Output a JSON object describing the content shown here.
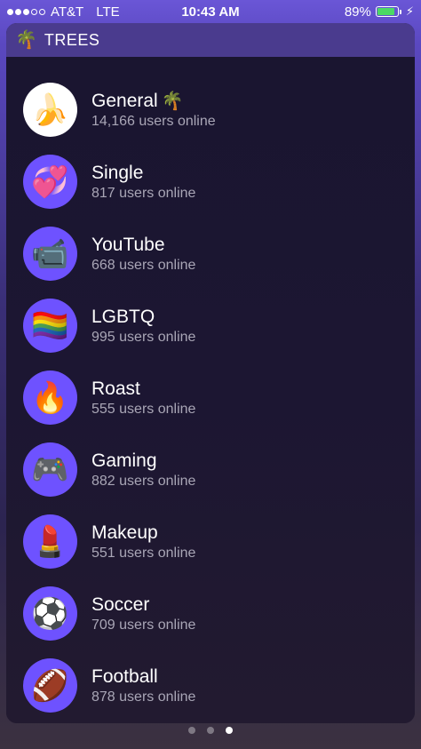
{
  "status_bar": {
    "carrier": "AT&T",
    "network": "LTE",
    "time": "10:43 AM",
    "battery_percent": "89%",
    "battery_level": 0.89,
    "signal_bars": 3,
    "signal_total": 5
  },
  "widget": {
    "title": "TREES",
    "icon": "palm-tree-icon",
    "icon_glyph": "🌴"
  },
  "rooms": [
    {
      "name": "General",
      "name_emoji": "🌴",
      "count": "14,166 users online",
      "icon": "banana-icon",
      "glyph": "🍌",
      "bg": "#ffffff"
    },
    {
      "name": "Single",
      "count": "817 users online",
      "icon": "two-hearts-icon",
      "glyph": "💞",
      "bg": "#6e52ff"
    },
    {
      "name": "YouTube",
      "count": "668 users online",
      "icon": "video-camera-icon",
      "glyph": "📹",
      "bg": "#6e52ff"
    },
    {
      "name": "LGBTQ",
      "count": "995 users online",
      "icon": "rainbow-flag-icon",
      "glyph": "🏳️‍🌈",
      "bg": "#6e52ff"
    },
    {
      "name": "Roast",
      "count": "555 users online",
      "icon": "fire-icon",
      "glyph": "🔥",
      "bg": "#6e52ff"
    },
    {
      "name": "Gaming",
      "count": "882 users online",
      "icon": "game-controller-icon",
      "glyph": "🎮",
      "bg": "#6e52ff"
    },
    {
      "name": "Makeup",
      "count": "551 users online",
      "icon": "lipstick-icon",
      "glyph": "💄",
      "bg": "#6e52ff"
    },
    {
      "name": "Soccer",
      "count": "709 users online",
      "icon": "soccer-ball-icon",
      "glyph": "⚽",
      "bg": "#6e52ff"
    },
    {
      "name": "Football",
      "count": "878 users online",
      "icon": "american-football-icon",
      "glyph": "🏈",
      "bg": "#6e52ff"
    }
  ],
  "page_indicator": {
    "total": 3,
    "active": 3
  }
}
